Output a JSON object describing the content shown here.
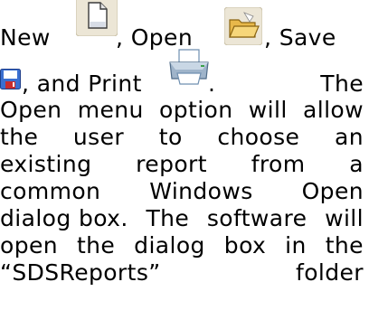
{
  "paragraph": {
    "line1": {
      "w1": "New",
      "w2": ", Open",
      "w3": ", Save"
    },
    "line2": {
      "w1": ", and Print",
      "w2": ".",
      "w3": "The"
    },
    "lines": [
      [
        "Open",
        "menu",
        "option",
        "will",
        "allow"
      ],
      [
        "the",
        "user",
        "to",
        "choose",
        "an"
      ],
      [
        "existing",
        "report",
        "from",
        "a"
      ],
      [
        "common",
        "Windows",
        "Open"
      ],
      [
        "dialog box.",
        "The",
        "software",
        "will"
      ],
      [
        "open",
        "the",
        "dialog",
        "box",
        "in",
        "the"
      ],
      [
        "“SDSReports”",
        "folder"
      ]
    ]
  },
  "icons": [
    "new-document-icon",
    "open-folder-icon",
    "save-floppy-icon",
    "print-printer-icon"
  ]
}
